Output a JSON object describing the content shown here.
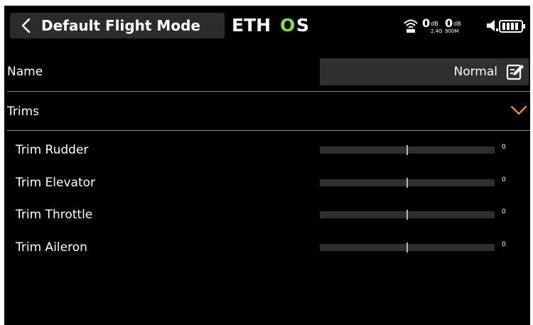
{
  "header": {
    "title": "Default Flight Mode",
    "brand": "ETHOS",
    "status": {
      "rssi_1": "0",
      "rssi_1_unit": "dB",
      "rssi_2": "0",
      "rssi_2_unit": "dB",
      "band_1": "2.4G",
      "band_2": "900M"
    }
  },
  "name_row": {
    "label": "Name",
    "value": "Normal"
  },
  "trims_section": {
    "label": "Trims",
    "expanded": true
  },
  "trims": [
    {
      "label": "Trim Rudder",
      "value": "0"
    },
    {
      "label": "Trim Elevator",
      "value": "0"
    },
    {
      "label": "Trim Throttle",
      "value": "0"
    },
    {
      "label": "Trim Aileron",
      "value": "0"
    }
  ],
  "colors": {
    "background": "#000000",
    "accent": "#ff9a1f",
    "logo_accent": "#7ee04a",
    "field": "#2f2f2f"
  },
  "icons": [
    "back-icon",
    "rssi-icon",
    "speaker-icon",
    "battery-icon",
    "edit-icon",
    "chevron-down-icon"
  ]
}
